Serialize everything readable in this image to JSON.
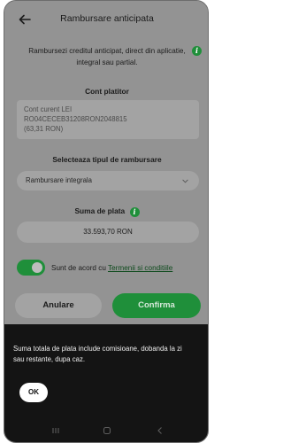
{
  "header": {
    "title": "Rambursare anticipata",
    "back_icon": "arrow-left-icon"
  },
  "intro": {
    "text": "Rambursezi creditul anticipat, direct din aplicatie, integral sau partial.",
    "info_icon": "i"
  },
  "account": {
    "label": "Cont platitor",
    "line1": "Cont curent LEI",
    "line2": "RO04CECEB31208RON2048815",
    "line3": "(63,31 RON)"
  },
  "repayment_type": {
    "label": "Selecteaza tipul de rambursare",
    "selected": "Rambursare integrala"
  },
  "amount": {
    "label": "Suma de plata",
    "info_icon": "i",
    "value": "33.593,70 RON"
  },
  "agreement": {
    "text": "Sunt de acord cu ",
    "link": "Termenii si conditiile",
    "checked": true
  },
  "buttons": {
    "cancel": "Anulare",
    "confirm": "Confirma"
  },
  "modal": {
    "message": "Suma totala de plata include comisioane, dobanda la zi sau restante, dupa caz.",
    "ok": "OK"
  },
  "colors": {
    "accent": "#1f8f3a",
    "overlay": "#939393",
    "sheet": "#141414"
  }
}
